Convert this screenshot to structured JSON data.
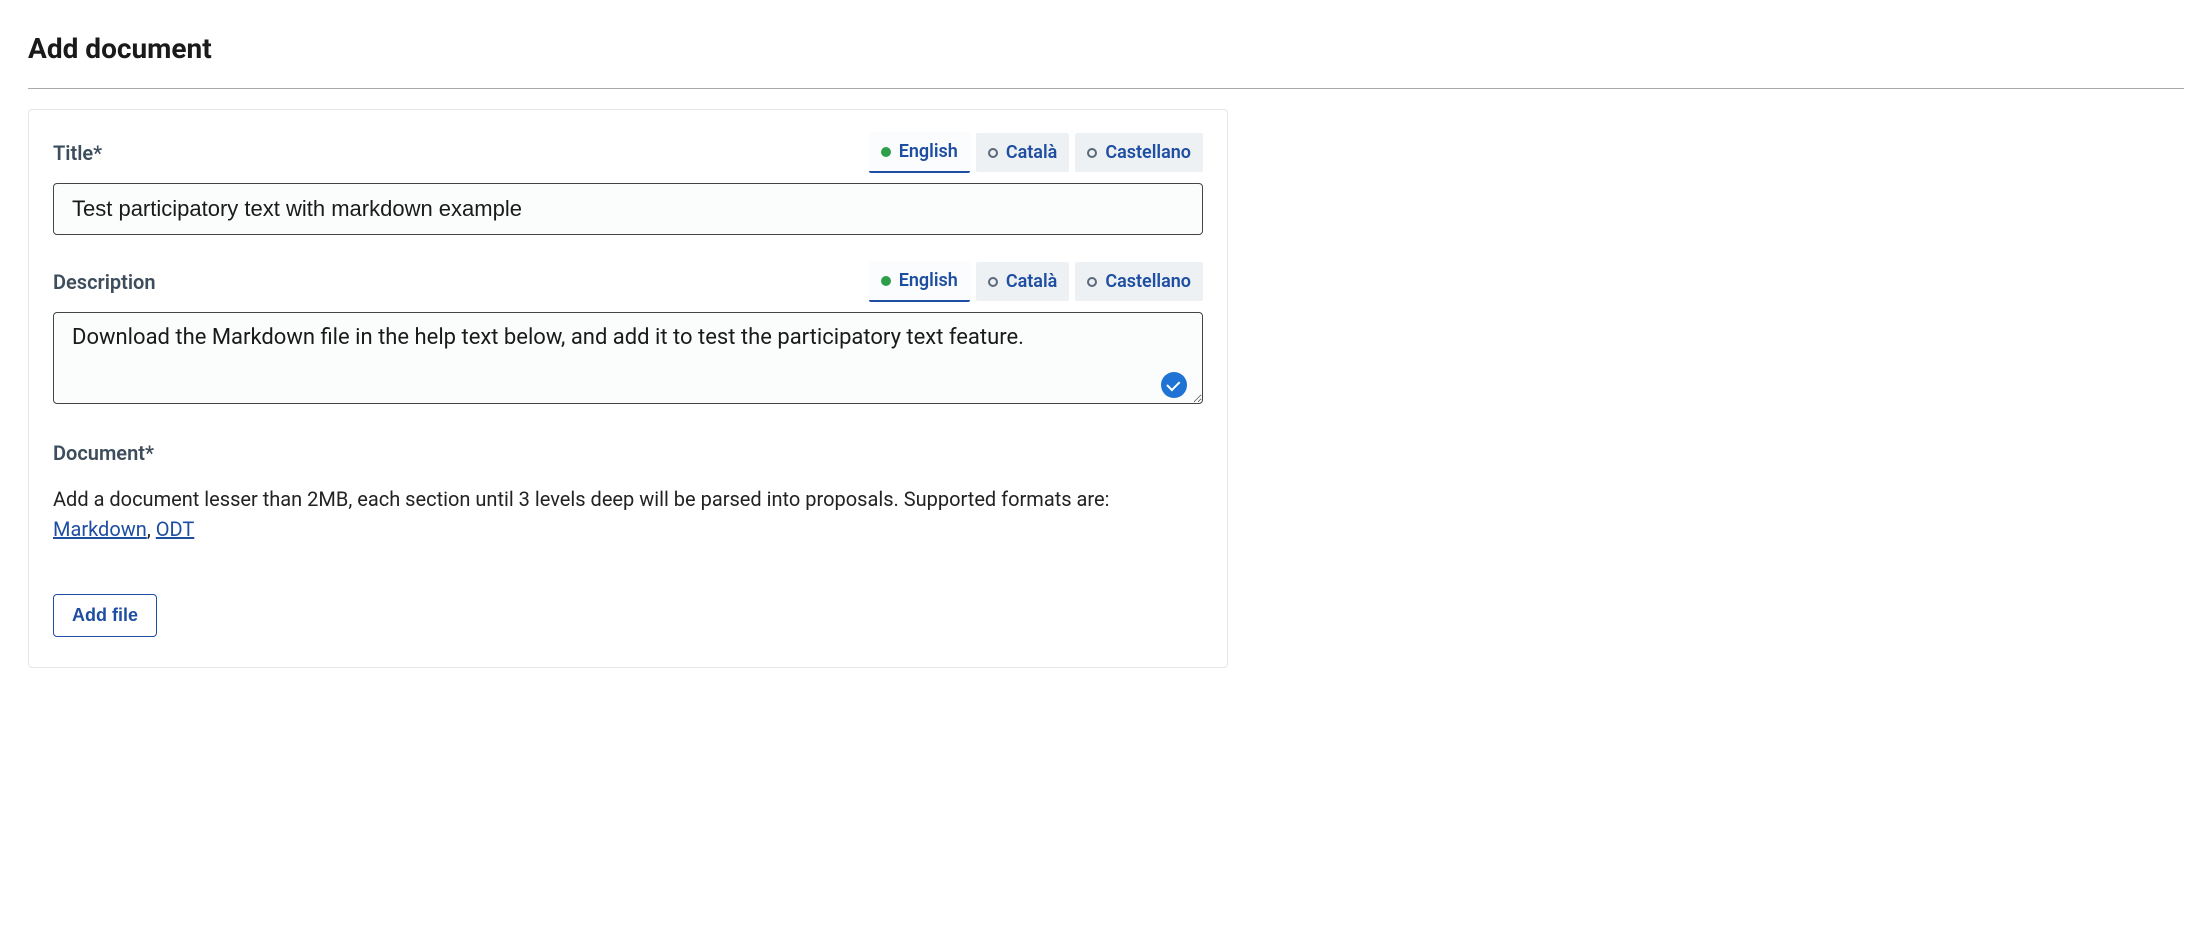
{
  "page_title": "Add document",
  "languages": [
    {
      "label": "English",
      "active": true,
      "filled": true
    },
    {
      "label": "Català",
      "active": false,
      "filled": false
    },
    {
      "label": "Castellano",
      "active": false,
      "filled": false
    }
  ],
  "title_field": {
    "label": "Title*",
    "value": "Test participatory text with markdown example"
  },
  "description_field": {
    "label": "Description",
    "value": "Download the Markdown file in the help text below, and add it to test the participatory text feature."
  },
  "document_field": {
    "label": "Document*",
    "help_prefix": "Add a document lesser than 2MB, each section until 3 levels deep will be parsed into proposals. Supported formats are: ",
    "link_markdown": "Markdown",
    "sep": ", ",
    "link_odt": "ODT"
  },
  "add_file_button": "Add file"
}
